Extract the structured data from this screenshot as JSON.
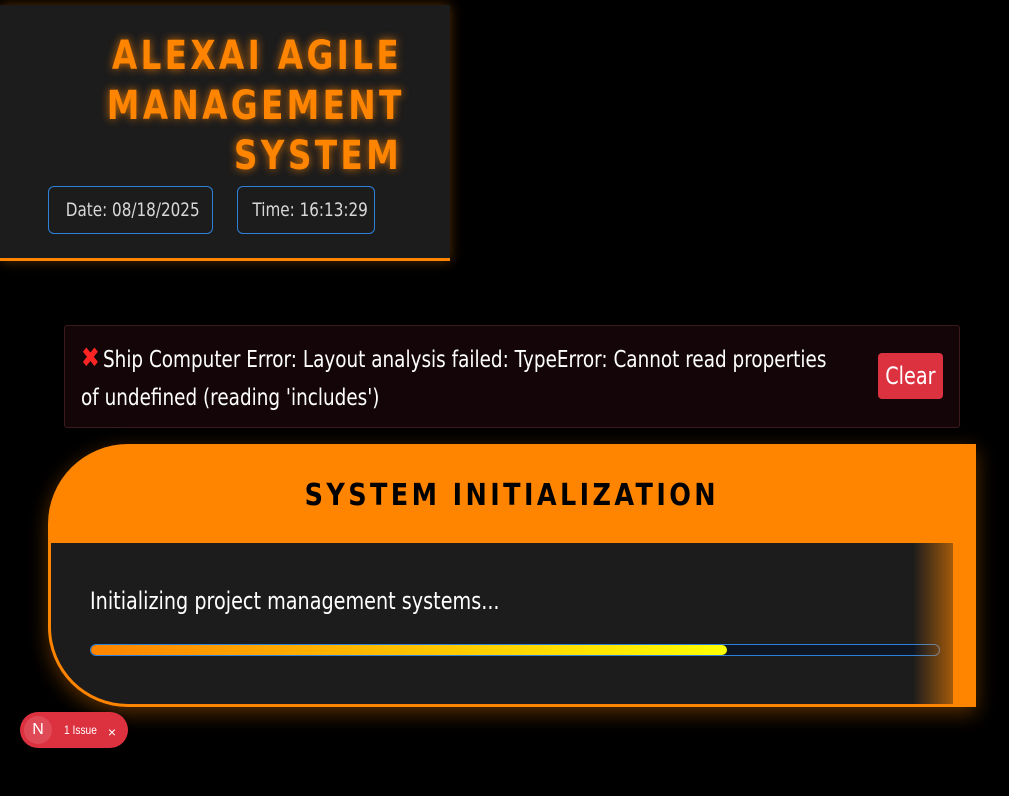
{
  "header": {
    "title": "ALEXAI AGILE MANAGEMENT SYSTEM",
    "date_label": "Date: 08/18/2025",
    "time_label": "Time: 16:13:29"
  },
  "error": {
    "icon": "cross-mark-icon",
    "message": "Ship Computer Error: Layout analysis failed: TypeError: Cannot read properties of undefined (reading 'includes')",
    "clear_label": "Clear"
  },
  "init": {
    "title": "SYSTEM INITIALIZATION",
    "status": "Initializing project management systems...",
    "progress_fraction": 0.75
  },
  "issues": {
    "logo_letter": "N",
    "label": "1 Issue",
    "close_symbol": "×"
  },
  "colors": {
    "accent": "#ff8400",
    "error_red": "#dc3240",
    "info_border": "#2f80d8",
    "progress_end": "#ffff00"
  }
}
